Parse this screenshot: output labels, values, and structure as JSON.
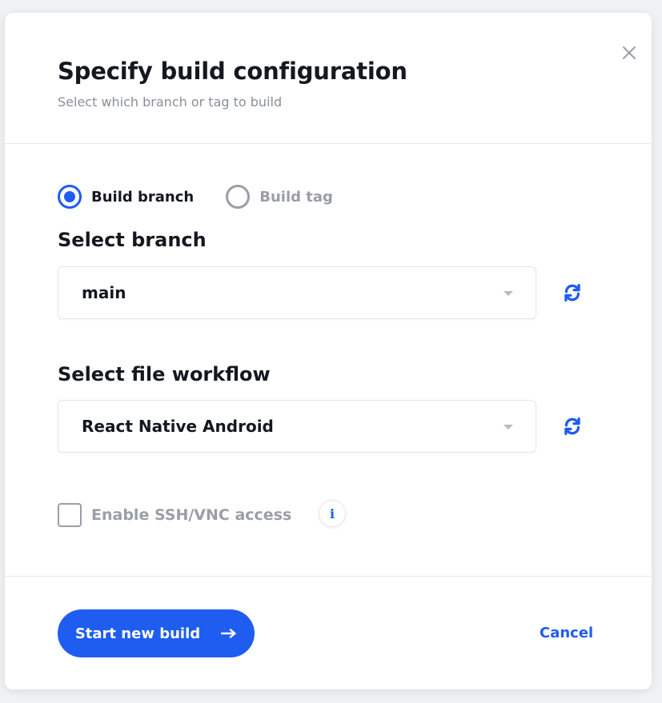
{
  "dialog": {
    "title": "Specify build configuration",
    "subtitle": "Select which branch or tag to build",
    "close_icon": "close-icon"
  },
  "build_mode": {
    "options": [
      {
        "label": "Build branch",
        "checked": true
      },
      {
        "label": "Build tag",
        "checked": false
      }
    ]
  },
  "branch": {
    "label": "Select branch",
    "value": "main",
    "refresh_icon": "refresh-icon"
  },
  "workflow": {
    "label": "Select file workflow",
    "value": "React Native Android",
    "refresh_icon": "refresh-icon"
  },
  "ssh": {
    "label": "Enable SSH/VNC access",
    "checked": false,
    "info_icon": "info-icon",
    "info_glyph": "i"
  },
  "footer": {
    "start_label": "Start new build",
    "start_icon": "arrow-right-icon",
    "cancel_label": "Cancel"
  },
  "colors": {
    "accent": "#1f5cf0",
    "text": "#14181f",
    "muted": "#9a9ea6"
  }
}
